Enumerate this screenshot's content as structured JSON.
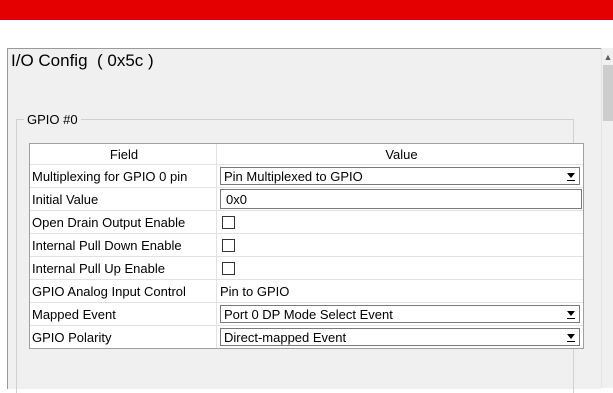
{
  "panel": {
    "title": "I/O Config  ( 0x5c )"
  },
  "group": {
    "legend": "GPIO #0"
  },
  "table": {
    "headers": {
      "field": "Field",
      "value": "Value"
    },
    "rows": {
      "mux": {
        "label": "Multiplexing for GPIO 0 pin",
        "value": "Pin Multiplexed to GPIO"
      },
      "initial": {
        "label": "Initial Value",
        "value": "0x0"
      },
      "open_drain": {
        "label": "Open Drain Output Enable",
        "checked": false
      },
      "pull_down": {
        "label": "Internal Pull Down Enable",
        "checked": false
      },
      "pull_up": {
        "label": "Internal Pull Up Enable",
        "checked": false
      },
      "analog": {
        "label": "GPIO Analog Input Control",
        "value": "Pin to GPIO"
      },
      "mapped_event": {
        "label": "Mapped Event",
        "value": "Port 0 DP Mode Select Event"
      },
      "polarity": {
        "label": "GPIO Polarity",
        "value": "Direct-mapped Event"
      }
    }
  },
  "icons": {
    "scroll_up": "chevron-up-icon",
    "dropdown": "dropdown-arrow-icon"
  },
  "colors": {
    "header_bar": "#e40000",
    "panel_bg": "#f0f0f0"
  }
}
